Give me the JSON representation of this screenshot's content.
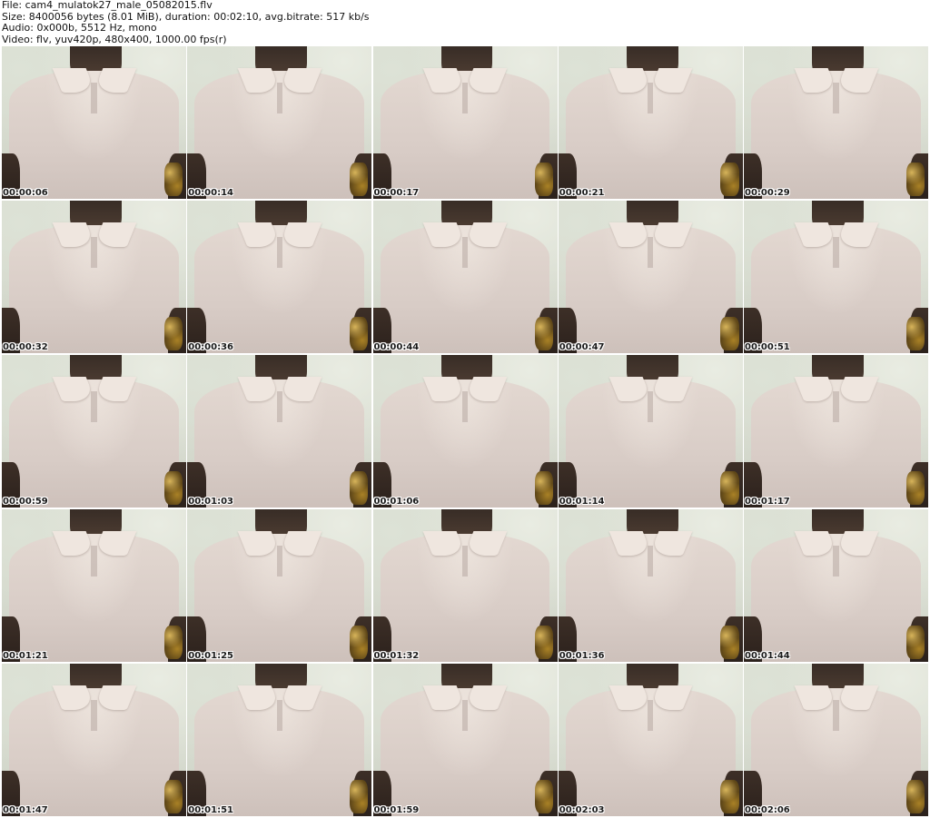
{
  "header": {
    "file_line": "File: cam4_mulatok27_male_05082015.flv",
    "size_line": "Size: 8400056 bytes (8.01 MiB), duration: 00:02:10, avg.bitrate: 517 kb/s",
    "audio_line": "Audio: 0x000b, 5512 Hz, mono",
    "video_line": "Video: flv, yuv420p, 480x400, 1000.00 fps(r)"
  },
  "thumbnails": [
    {
      "timestamp": "00:00:06"
    },
    {
      "timestamp": "00:00:14"
    },
    {
      "timestamp": "00:00:17"
    },
    {
      "timestamp": "00:00:21"
    },
    {
      "timestamp": "00:00:29"
    },
    {
      "timestamp": "00:00:32"
    },
    {
      "timestamp": "00:00:36"
    },
    {
      "timestamp": "00:00:44"
    },
    {
      "timestamp": "00:00:47"
    },
    {
      "timestamp": "00:00:51"
    },
    {
      "timestamp": "00:00:59"
    },
    {
      "timestamp": "00:01:03"
    },
    {
      "timestamp": "00:01:06"
    },
    {
      "timestamp": "00:01:14"
    },
    {
      "timestamp": "00:01:17"
    },
    {
      "timestamp": "00:01:21"
    },
    {
      "timestamp": "00:01:25"
    },
    {
      "timestamp": "00:01:32"
    },
    {
      "timestamp": "00:01:36"
    },
    {
      "timestamp": "00:01:44"
    },
    {
      "timestamp": "00:01:47"
    },
    {
      "timestamp": "00:01:51"
    },
    {
      "timestamp": "00:01:59"
    },
    {
      "timestamp": "00:02:03"
    },
    {
      "timestamp": "00:02:06"
    }
  ]
}
